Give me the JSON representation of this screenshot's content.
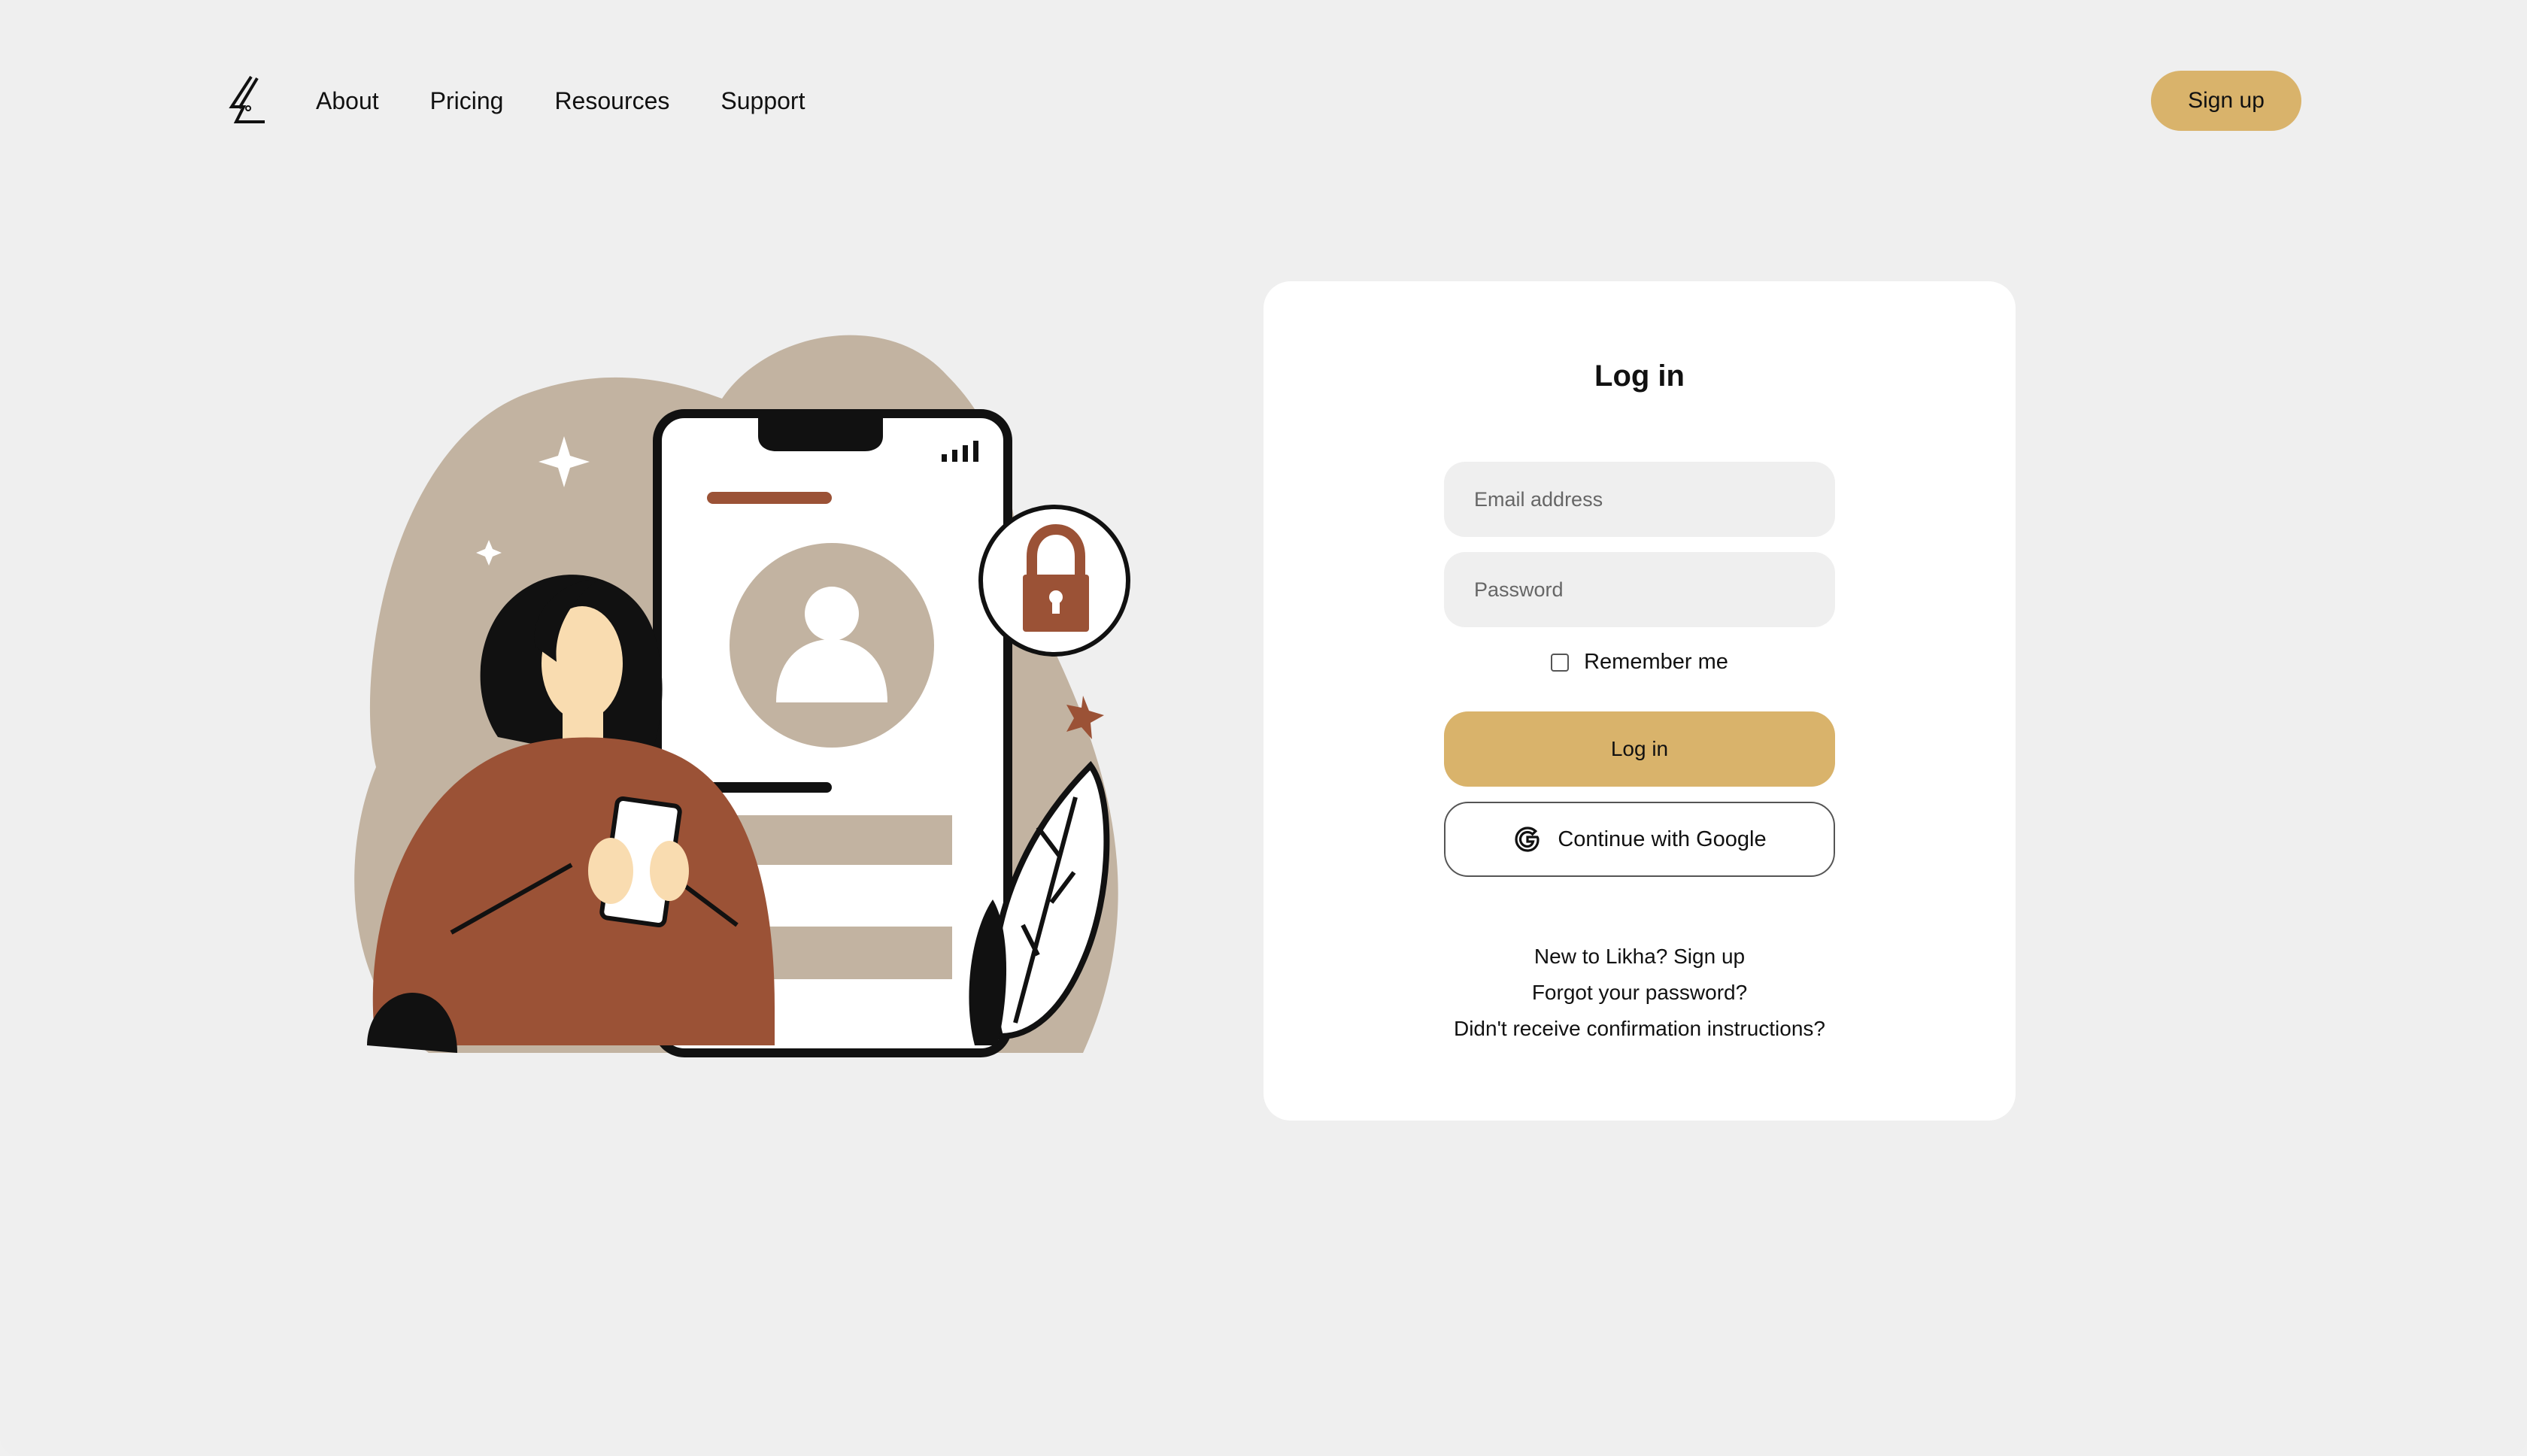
{
  "nav": {
    "items": [
      {
        "label": "About"
      },
      {
        "label": "Pricing"
      },
      {
        "label": "Resources"
      },
      {
        "label": "Support"
      }
    ],
    "signup_label": "Sign up"
  },
  "login": {
    "title": "Log in",
    "email_placeholder": "Email address",
    "password_placeholder": "Password",
    "remember_label": "Remember me",
    "remember_checked": false,
    "login_button": "Log in",
    "google_button": "Continue with Google",
    "links": {
      "signup": "New to Likha? Sign up",
      "forgot": "Forgot your password?",
      "confirmation": "Didn't receive confirmation instructions?"
    }
  },
  "colors": {
    "background": "#efefef",
    "accent": "#d9b36b",
    "card": "#ffffff",
    "illustration_taupe": "#c2b3a1",
    "illustration_rust": "#9b5236"
  },
  "icons": {
    "logo": "likha-logo-icon",
    "google": "google-g-icon",
    "lock": "padlock-icon",
    "user": "user-avatar-icon"
  }
}
